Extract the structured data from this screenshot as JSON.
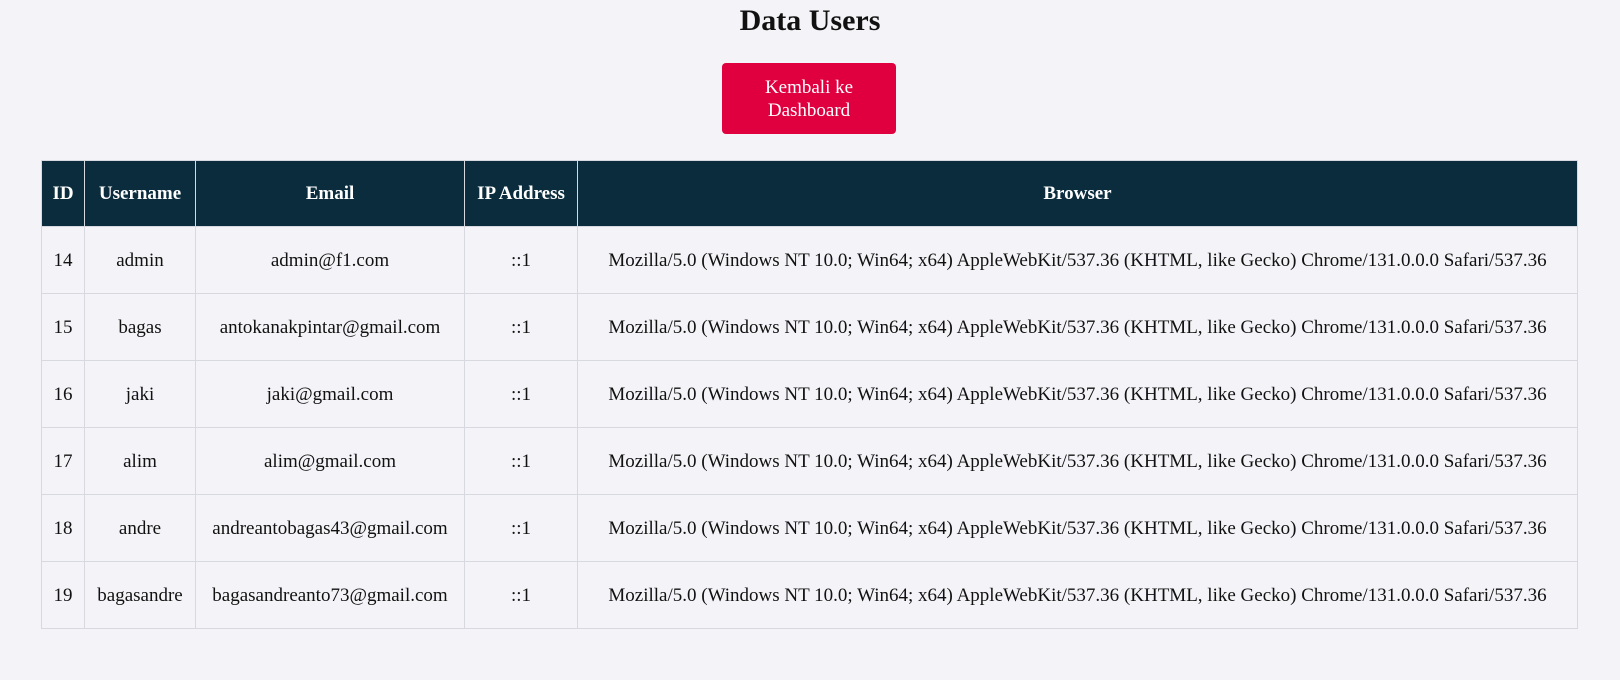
{
  "page": {
    "title": "Data Users",
    "back_button_label": "Kembali ke Dashboard"
  },
  "colors": {
    "background": "#f4f4f8",
    "button": "#e0003f",
    "table_header": "#0a2c3d",
    "border": "#d8d8e0"
  },
  "table": {
    "headers": {
      "id": "ID",
      "username": "Username",
      "email": "Email",
      "ip": "IP Address",
      "browser": "Browser"
    },
    "rows": [
      {
        "id": "14",
        "username": "admin",
        "email": "admin@f1.com",
        "ip": "::1",
        "browser": "Mozilla/5.0 (Windows NT 10.0; Win64; x64) AppleWebKit/537.36 (KHTML, like Gecko) Chrome/131.0.0.0 Safari/537.36"
      },
      {
        "id": "15",
        "username": "bagas",
        "email": "antokanakpintar@gmail.com",
        "ip": "::1",
        "browser": "Mozilla/5.0 (Windows NT 10.0; Win64; x64) AppleWebKit/537.36 (KHTML, like Gecko) Chrome/131.0.0.0 Safari/537.36"
      },
      {
        "id": "16",
        "username": "jaki",
        "email": "jaki@gmail.com",
        "ip": "::1",
        "browser": "Mozilla/5.0 (Windows NT 10.0; Win64; x64) AppleWebKit/537.36 (KHTML, like Gecko) Chrome/131.0.0.0 Safari/537.36"
      },
      {
        "id": "17",
        "username": "alim",
        "email": "alim@gmail.com",
        "ip": "::1",
        "browser": "Mozilla/5.0 (Windows NT 10.0; Win64; x64) AppleWebKit/537.36 (KHTML, like Gecko) Chrome/131.0.0.0 Safari/537.36"
      },
      {
        "id": "18",
        "username": "andre",
        "email": "andreantobagas43@gmail.com",
        "ip": "::1",
        "browser": "Mozilla/5.0 (Windows NT 10.0; Win64; x64) AppleWebKit/537.36 (KHTML, like Gecko) Chrome/131.0.0.0 Safari/537.36"
      },
      {
        "id": "19",
        "username": "bagasandre",
        "email": "bagasandreanto73@gmail.com",
        "ip": "::1",
        "browser": "Mozilla/5.0 (Windows NT 10.0; Win64; x64) AppleWebKit/537.36 (KHTML, like Gecko) Chrome/131.0.0.0 Safari/537.36"
      }
    ]
  }
}
